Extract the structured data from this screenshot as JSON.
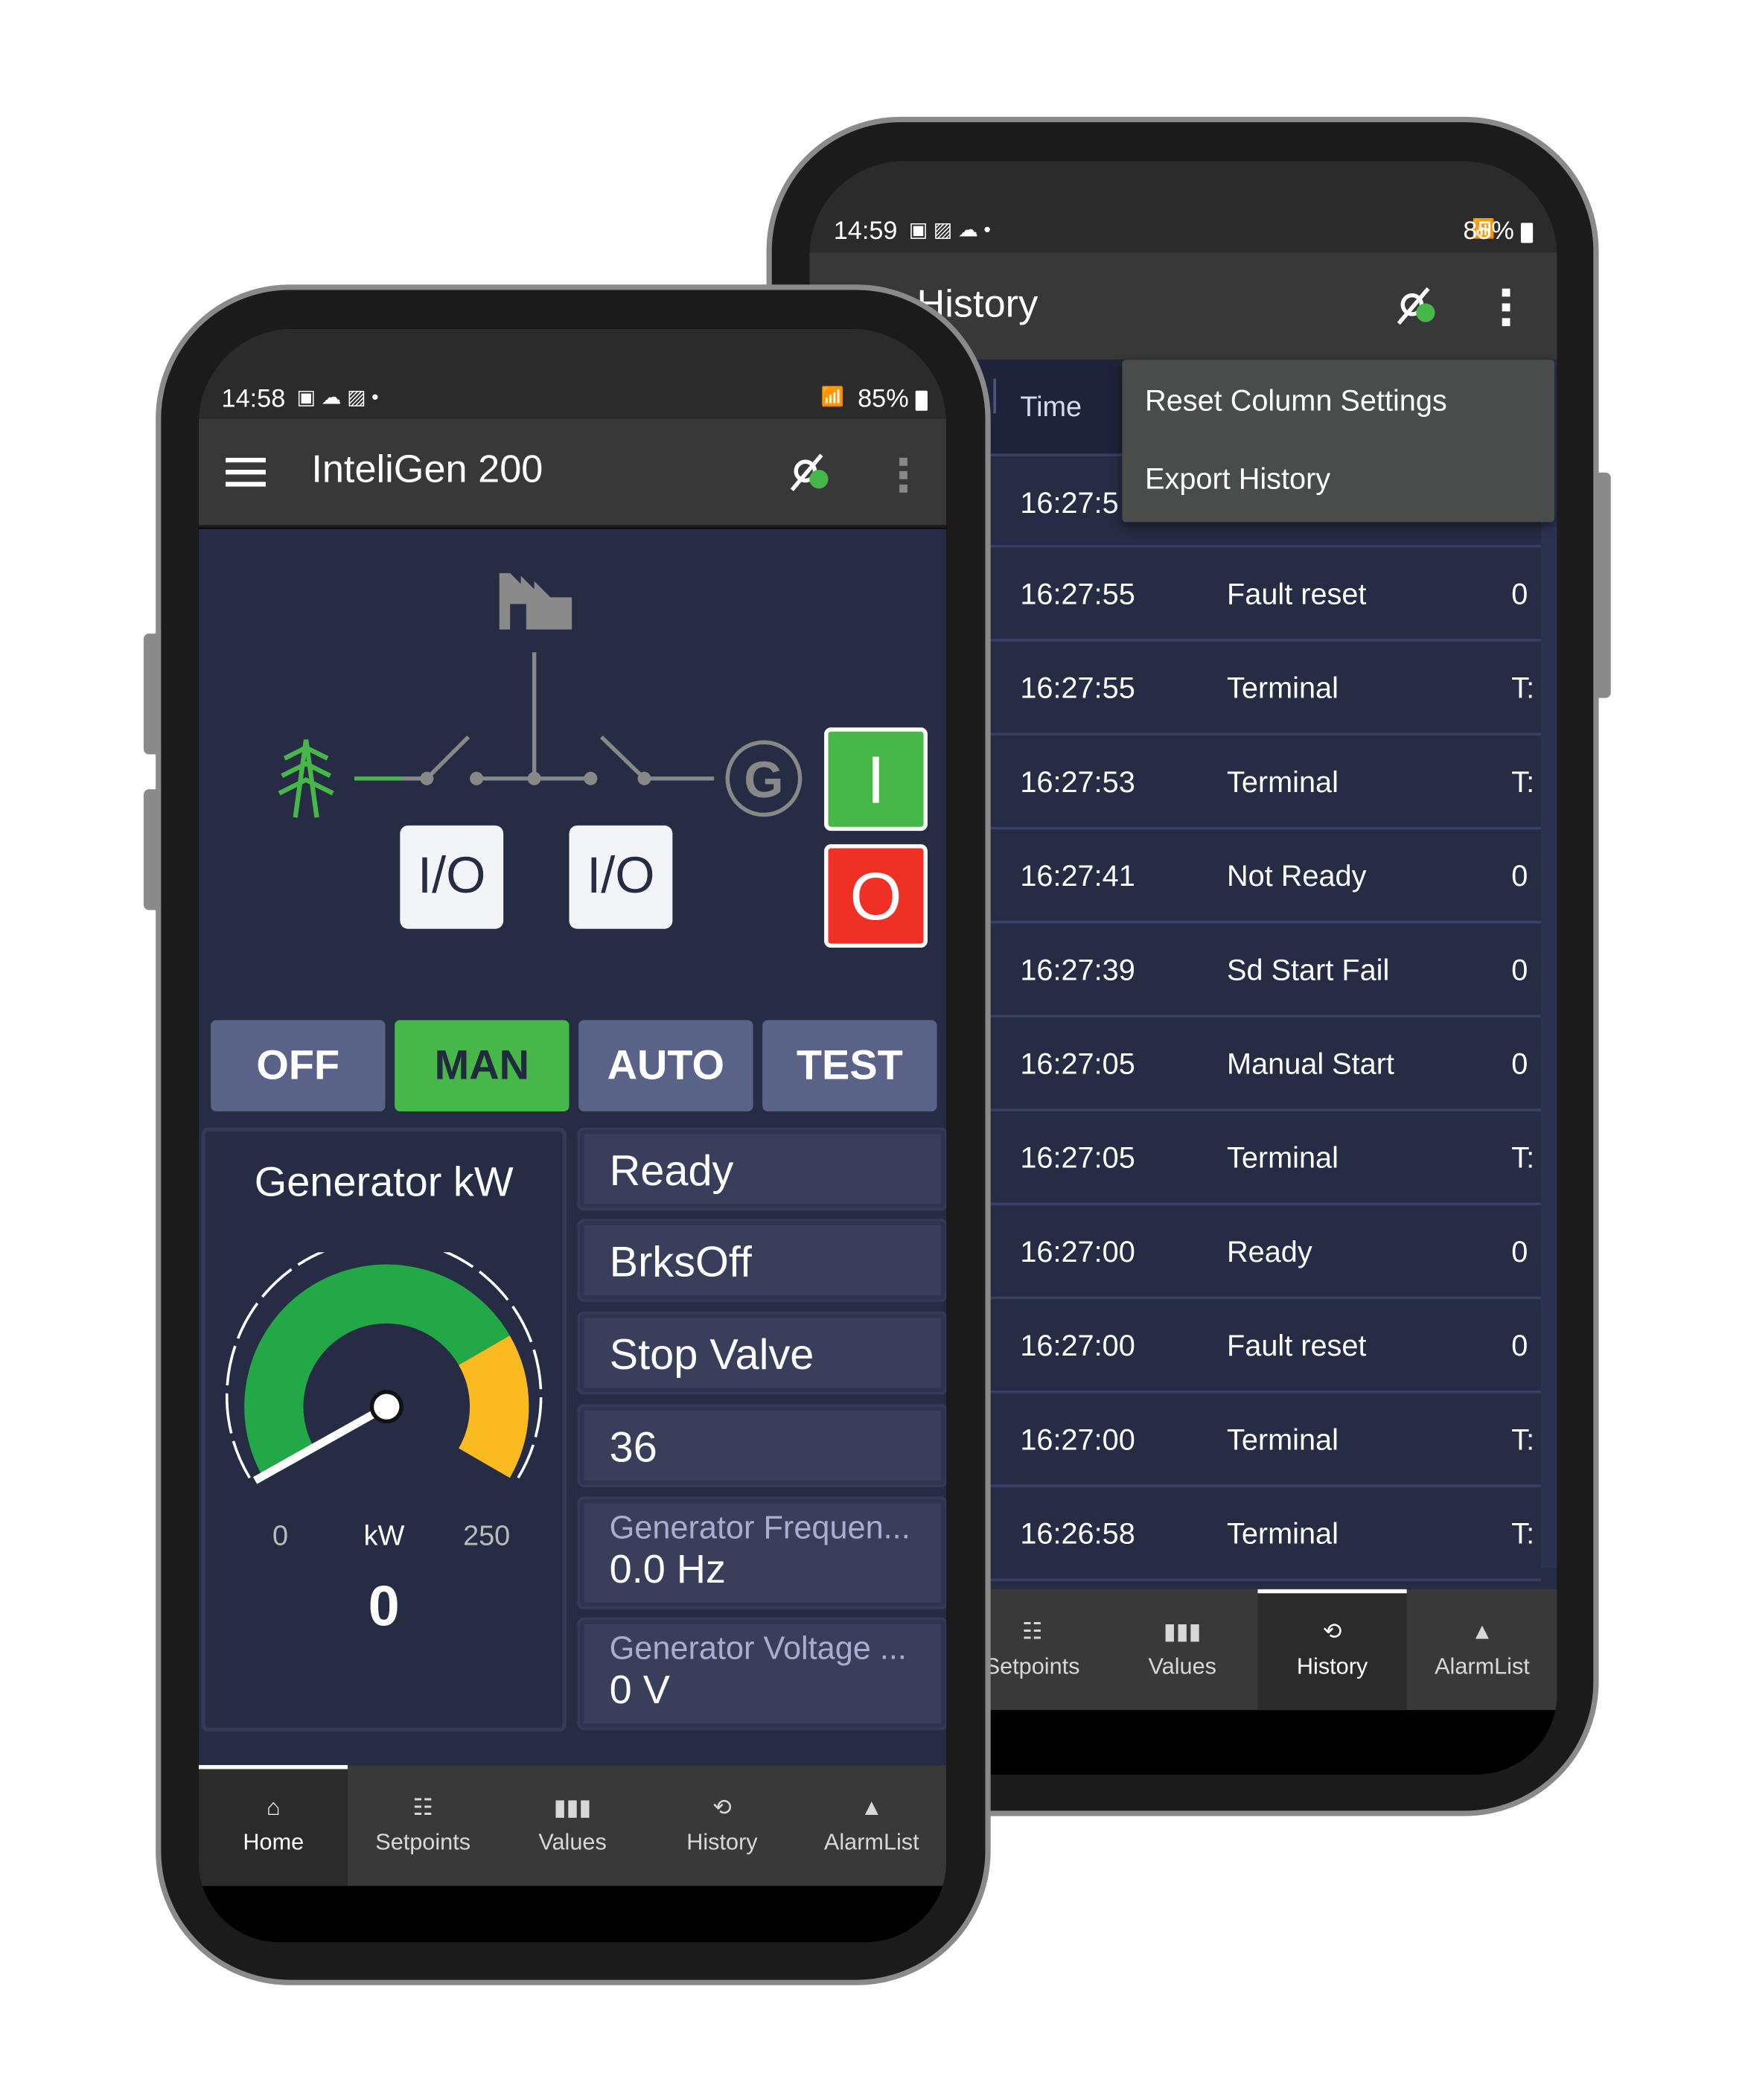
{
  "back_phone": {
    "status": {
      "time": "14:59",
      "battery": "85%"
    },
    "title": "History",
    "table": {
      "header_time": "Time",
      "rows": [
        {
          "time": "16:27:5",
          "event": "",
          "value": ""
        },
        {
          "time": "16:27:55",
          "event": "Fault reset",
          "value": "0"
        },
        {
          "time": "16:27:55",
          "event": "Terminal",
          "value": "T:"
        },
        {
          "time": "16:27:53",
          "event": "Terminal",
          "value": "T:"
        },
        {
          "time": "16:27:41",
          "event": "Not Ready",
          "value": "0"
        },
        {
          "time": "16:27:39",
          "event": "Sd Start Fail",
          "value": "0"
        },
        {
          "time": "16:27:05",
          "event": "Manual Start",
          "value": "0"
        },
        {
          "time": "16:27:05",
          "event": "Terminal",
          "value": "T:"
        },
        {
          "time": "16:27:00",
          "event": "Ready",
          "value": "0"
        },
        {
          "time": "16:27:00",
          "event": "Fault reset",
          "value": "0"
        },
        {
          "time": "16:27:00",
          "event": "Terminal",
          "value": "T:"
        },
        {
          "time": "16:26:58",
          "event": "Terminal",
          "value": "T:"
        }
      ]
    },
    "menu": {
      "items": [
        "Reset Column Settings",
        "Export History"
      ]
    },
    "nav": [
      "Setpoints",
      "Values",
      "History",
      "AlarmList"
    ],
    "active_tab": "History"
  },
  "front_phone": {
    "status": {
      "time": "14:58",
      "battery": "85%"
    },
    "title": "InteliGen 200",
    "diagram": {
      "io_label": "I/O",
      "start_label": "I",
      "stop_label": "O",
      "generator_label": "G"
    },
    "modes": [
      "OFF",
      "MAN",
      "AUTO",
      "TEST"
    ],
    "active_mode": "MAN",
    "gauge": {
      "title": "Generator kW",
      "min": "0",
      "max": "250",
      "unit": "kW",
      "value": "0",
      "green_fraction": 0.75
    },
    "cards": {
      "state1": "Ready",
      "state2": "BrksOff",
      "state3": "Stop Valve",
      "number": "36",
      "freq_label": "Generator Frequen...",
      "freq_value": "0.0  Hz",
      "volt_label": "Generator Voltage ...",
      "volt_value": "0  V"
    },
    "nav": [
      "Home",
      "Setpoints",
      "Values",
      "History",
      "AlarmList"
    ],
    "active_tab": "Home"
  },
  "colors": {
    "green": "#47b749",
    "red": "#ee3124",
    "panel": "#262c43",
    "appbar": "#383838"
  }
}
